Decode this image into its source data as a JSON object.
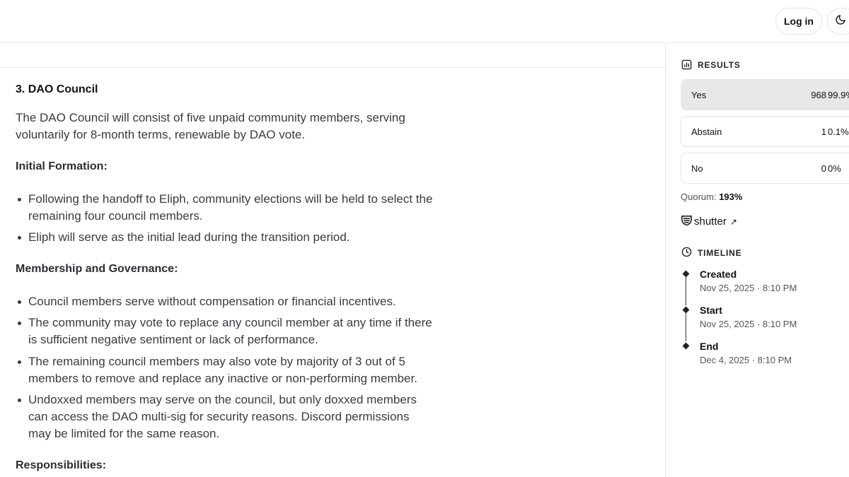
{
  "header": {
    "login_label": "Log in",
    "theme_icon": "moon-icon"
  },
  "content": {
    "section_title": "3. DAO Council",
    "intro": "The DAO Council will consist of five unpaid community members, serving voluntarily for 8-month terms, renewable by DAO vote.",
    "initial_formation": {
      "heading": "Initial Formation:",
      "items": [
        "Following the handoff to Eliph, community elections will be held to select the remaining four council members.",
        "Eliph will serve as the initial lead during the transition period."
      ]
    },
    "membership": {
      "heading": "Membership and Governance:",
      "items": [
        "Council members serve without compensation or financial incentives.",
        "The community may vote to replace any council member at any time if there is sufficient negative sentiment or lack of performance.",
        "The remaining council members may also vote by majority of 3 out of 5 members to remove and replace any inactive or non-performing member.",
        "Undoxxed members may serve on the council, but only doxxed members can access the DAO multi-sig for security reasons. Discord permissions may be limited for the same reason."
      ]
    },
    "responsibilities_heading": "Responsibilities:"
  },
  "sidebar": {
    "results": {
      "title": "RESULTS",
      "icon": "bar-chart-icon",
      "rows": [
        {
          "choice": "Yes",
          "count": "968",
          "percent": "99.9%",
          "fraction": 0.999
        },
        {
          "choice": "Abstain",
          "count": "1",
          "percent": "0.1%",
          "fraction": 0.001
        },
        {
          "choice": "No",
          "count": "0",
          "percent": "0%",
          "fraction": 0
        }
      ],
      "quorum_label": "Quorum:",
      "quorum_value": "193%"
    },
    "shutter": {
      "label": "shutter",
      "icon": "shutter-shield-icon",
      "arrow": "↗"
    },
    "timeline": {
      "title": "TIMELINE",
      "icon": "clock-icon",
      "events": [
        {
          "label": "Created",
          "date": "Nov 25, 2025 · 8:10 PM"
        },
        {
          "label": "Start",
          "date": "Nov 25, 2025 · 8:10 PM"
        },
        {
          "label": "End",
          "date": "Dec 4, 2025 · 8:10 PM"
        }
      ]
    }
  }
}
